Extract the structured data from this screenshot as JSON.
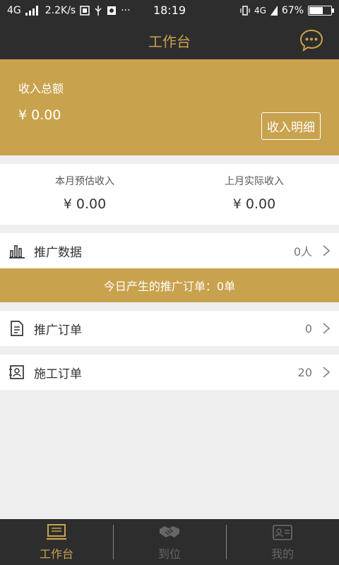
{
  "status": {
    "network": "4G",
    "speed": "2.2K/s",
    "time": "18:19",
    "network_right": "4G",
    "battery": "67%",
    "battery_level": 0.67
  },
  "header": {
    "title": "工作台"
  },
  "income": {
    "label": "收入总额",
    "amount": "¥ 0.00",
    "detail_button": "收入明细"
  },
  "summary": {
    "this_month_label": "本月预估收入",
    "this_month_value": "¥ 0.00",
    "last_month_label": "上月实际收入",
    "last_month_value": "¥ 0.00"
  },
  "promo_data": {
    "label": "推广数据",
    "value": "0人"
  },
  "banner": {
    "text": "今日产生的推广订单：0单"
  },
  "promo_orders": {
    "label": "推广订单",
    "value": "0"
  },
  "build_orders": {
    "label": "施工订单",
    "value": "20"
  },
  "tabs": [
    {
      "label": "工作台",
      "icon": "workbench-icon"
    },
    {
      "label": "到位",
      "icon": "handshake-icon"
    },
    {
      "label": "我的",
      "icon": "profile-card-icon"
    }
  ],
  "colors": {
    "accent": "#c9a24e",
    "dark": "#2d2d2d",
    "background": "#efefef"
  }
}
